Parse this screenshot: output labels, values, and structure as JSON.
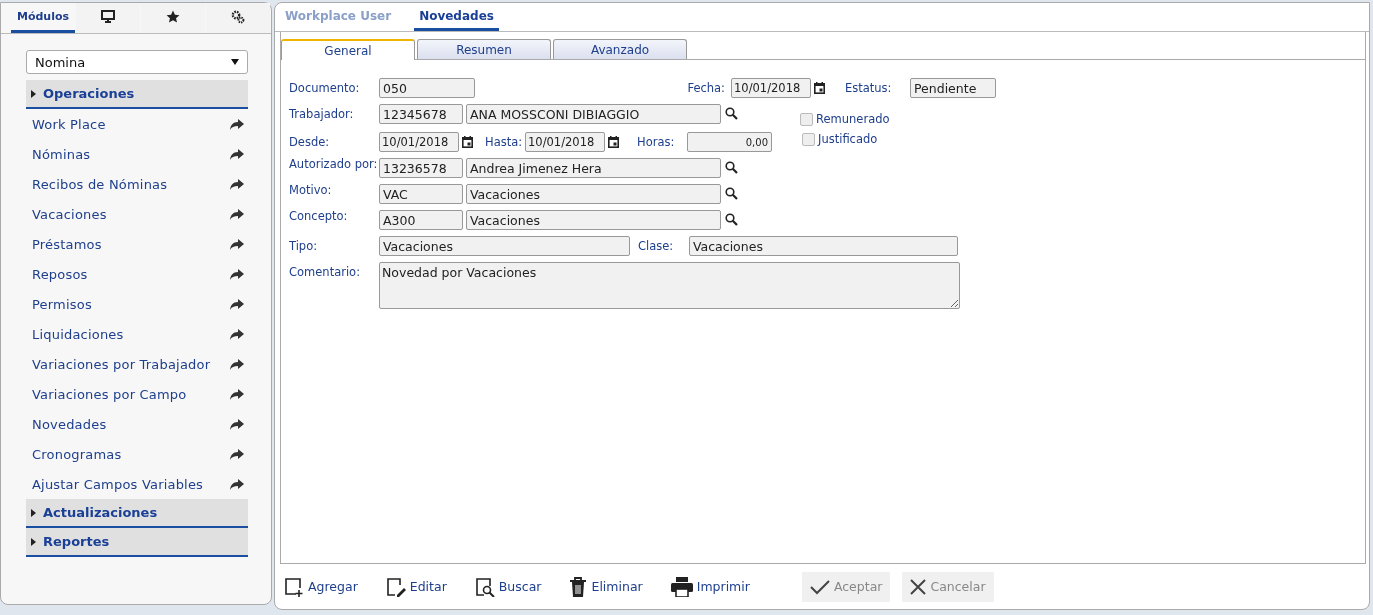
{
  "sidebar": {
    "tabs": [
      {
        "kind": "text",
        "label": "Módulos",
        "selected": true
      },
      {
        "kind": "monitor",
        "selected": false
      },
      {
        "kind": "star",
        "selected": false
      },
      {
        "kind": "gears",
        "selected": false
      }
    ],
    "module_select": {
      "value": "Nomina"
    },
    "sections": [
      {
        "title": "Operaciones",
        "items": [
          "Work Place",
          "Nóminas",
          "Recibos de Nóminas",
          "Vacaciones",
          "Préstamos",
          "Reposos",
          "Permisos",
          "Liquidaciones",
          "Variaciones por Trabajador",
          "Variaciones por Campo",
          "Novedades",
          "Cronogramas",
          "Ajustar Campos Variables"
        ]
      },
      {
        "title": "Actualizaciones"
      },
      {
        "title": "Reportes"
      }
    ]
  },
  "top_tabs": [
    {
      "label": "Workplace User",
      "selected": false
    },
    {
      "label": "Novedades",
      "selected": true
    }
  ],
  "form_tabs": [
    {
      "label": "General",
      "selected": true
    },
    {
      "label": "Resumen",
      "selected": false
    },
    {
      "label": "Avanzado",
      "selected": false
    }
  ],
  "form": {
    "documento": {
      "label": "Documento:",
      "value": "050"
    },
    "fecha": {
      "label": "Fecha:",
      "value": "10/01/2018"
    },
    "estatus": {
      "label": "Estatus:",
      "value": "Pendiente"
    },
    "trabajador": {
      "label": "Trabajador:",
      "code": "12345678",
      "name": "ANA MOSSCONI DIBIAGGIO"
    },
    "remunerado": {
      "label": "Remunerado",
      "checked": false
    },
    "desde": {
      "label": "Desde:",
      "value": "10/01/2018"
    },
    "hasta": {
      "label": "Hasta:",
      "value": "10/01/2018"
    },
    "horas": {
      "label": "Horas:",
      "value": "0,00"
    },
    "justificado": {
      "label": "Justificado",
      "checked": false
    },
    "autorizado": {
      "label": "Autorizado por:",
      "code": "13236578",
      "name": "Andrea Jimenez Hera"
    },
    "motivo": {
      "label": "Motivo:",
      "code": "VAC",
      "name": "Vacaciones"
    },
    "concepto": {
      "label": "Concepto:",
      "code": "A300",
      "name": "Vacaciones"
    },
    "tipo": {
      "label": "Tipo:",
      "value": "Vacaciones"
    },
    "clase": {
      "label": "Clase:",
      "value": "Vacaciones"
    },
    "comentario": {
      "label": "Comentario:",
      "value": "Novedad por Vacaciones"
    }
  },
  "toolbar": [
    {
      "kind": "add",
      "label": "Agregar",
      "disabled": false
    },
    {
      "kind": "edit",
      "label": "Editar",
      "disabled": false
    },
    {
      "kind": "search",
      "label": "Buscar",
      "disabled": false
    },
    {
      "kind": "delete",
      "label": "Eliminar",
      "disabled": false
    },
    {
      "kind": "print",
      "label": "Imprimir",
      "disabled": false
    },
    {
      "kind": "accept",
      "label": "Aceptar",
      "disabled": true
    },
    {
      "kind": "cancel",
      "label": "Cancelar",
      "disabled": true
    }
  ]
}
